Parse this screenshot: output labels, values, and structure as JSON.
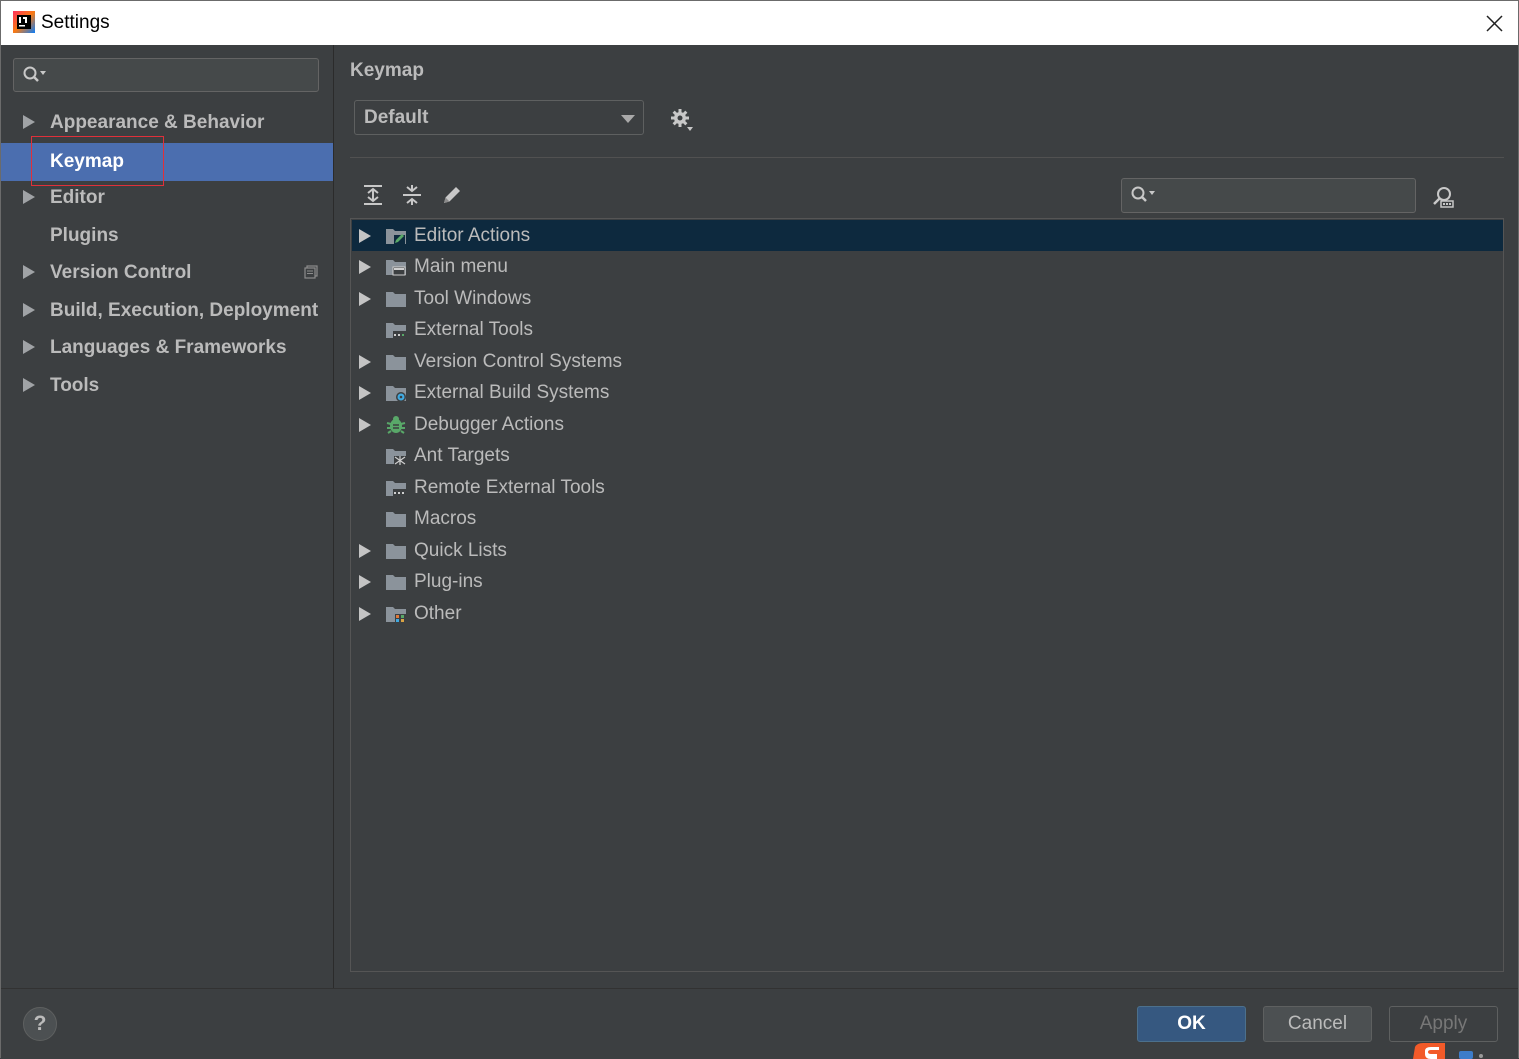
{
  "window": {
    "title": "Settings",
    "app_icon": "intellij-idea-icon",
    "close_icon": "close-icon"
  },
  "sidebar": {
    "search": {
      "value": "",
      "placeholder": ""
    },
    "items": [
      {
        "label": "Appearance & Behavior",
        "expandable": true,
        "selected": false
      },
      {
        "label": "Keymap",
        "expandable": false,
        "selected": true
      },
      {
        "label": "Editor",
        "expandable": true,
        "selected": false
      },
      {
        "label": "Plugins",
        "expandable": false,
        "selected": false
      },
      {
        "label": "Version Control",
        "expandable": true,
        "selected": false,
        "badge": "project-settings-icon"
      },
      {
        "label": "Build, Execution, Deployment",
        "expandable": true,
        "selected": false
      },
      {
        "label": "Languages & Frameworks",
        "expandable": true,
        "selected": false
      },
      {
        "label": "Tools",
        "expandable": true,
        "selected": false
      }
    ]
  },
  "panel": {
    "title": "Keymap",
    "keymap_select": {
      "value": "Default"
    },
    "toolbar": {
      "icons": [
        "expand-all-icon",
        "collapse-all-icon",
        "edit-icon"
      ]
    },
    "tree_search": {
      "value": "",
      "placeholder": ""
    },
    "tree": [
      {
        "label": "Editor Actions",
        "expandable": true,
        "selected": true,
        "icon": "editor-actions-folder-icon"
      },
      {
        "label": "Main menu",
        "expandable": true,
        "selected": false,
        "icon": "menu-folder-icon"
      },
      {
        "label": "Tool Windows",
        "expandable": true,
        "selected": false,
        "icon": "folder-icon"
      },
      {
        "label": "External Tools",
        "expandable": false,
        "selected": false,
        "icon": "external-tools-folder-icon"
      },
      {
        "label": "Version Control Systems",
        "expandable": true,
        "selected": false,
        "icon": "folder-icon"
      },
      {
        "label": "External Build Systems",
        "expandable": true,
        "selected": false,
        "icon": "build-systems-folder-icon"
      },
      {
        "label": "Debugger Actions",
        "expandable": true,
        "selected": false,
        "icon": "debugger-bug-icon"
      },
      {
        "label": "Ant Targets",
        "expandable": false,
        "selected": false,
        "icon": "ant-targets-folder-icon"
      },
      {
        "label": "Remote External Tools",
        "expandable": false,
        "selected": false,
        "icon": "external-tools-folder-icon"
      },
      {
        "label": "Macros",
        "expandable": false,
        "selected": false,
        "icon": "folder-icon"
      },
      {
        "label": "Quick Lists",
        "expandable": true,
        "selected": false,
        "icon": "folder-icon"
      },
      {
        "label": "Plug-ins",
        "expandable": true,
        "selected": false,
        "icon": "folder-icon"
      },
      {
        "label": "Other",
        "expandable": true,
        "selected": false,
        "icon": "other-folder-icon"
      }
    ]
  },
  "buttons": {
    "help": "?",
    "ok": "OK",
    "cancel": "Cancel",
    "apply": "Apply"
  },
  "colors": {
    "selection": "#4b6eaf",
    "tree_selection": "#0d293e",
    "background": "#3c3f41",
    "text": "#bbbbbb",
    "highlight_box": "#e0303a"
  }
}
